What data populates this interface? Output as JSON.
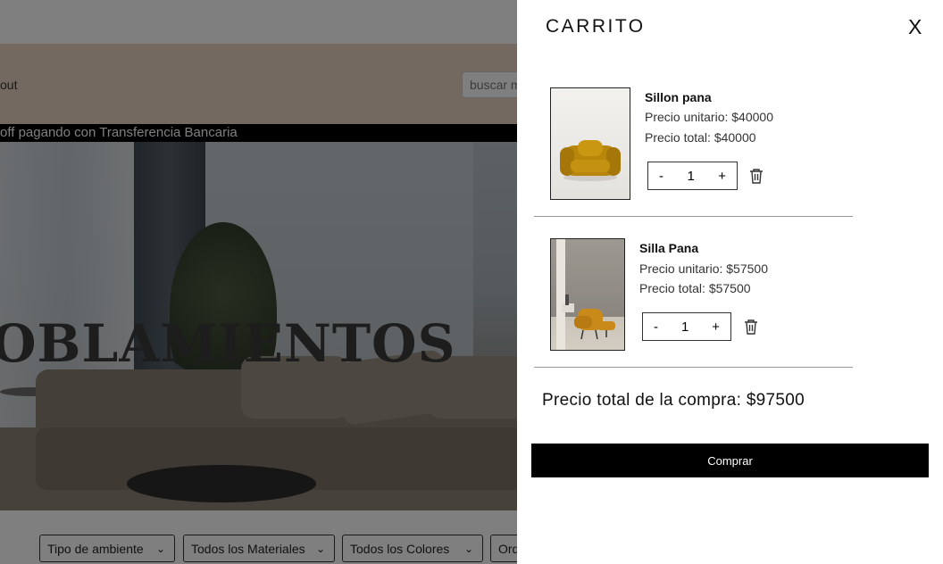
{
  "site": {
    "nav_about": "out",
    "search_placeholder": "buscar m",
    "promo": "off pagando con Transferencia Bancaria",
    "hero_title": "OBLAMIENTOS",
    "filters": [
      {
        "label": "Tipo de ambiente"
      },
      {
        "label": "Todos los Materiales"
      },
      {
        "label": "Todos los Colores"
      },
      {
        "label": "Ord"
      }
    ]
  },
  "cart": {
    "title": "CARRITO",
    "close_label": "X",
    "items": [
      {
        "name": "Sillon pana",
        "unit_price": "Precio unitario: $40000",
        "total_price": "Precio total: $40000",
        "qty_minus": "-",
        "quantity": "1",
        "qty_plus": "+",
        "image": "yellow-velvet-armchair"
      },
      {
        "name": "Silla Pana",
        "unit_price": "Precio unitario: $57500",
        "total_price": "Precio total: $57500",
        "qty_minus": "-",
        "quantity": "1",
        "qty_plus": "+",
        "image": "mustard-lounge-chair"
      }
    ],
    "grand_total": "Precio total de la compra: $97500",
    "buy_label": "Comprar"
  }
}
